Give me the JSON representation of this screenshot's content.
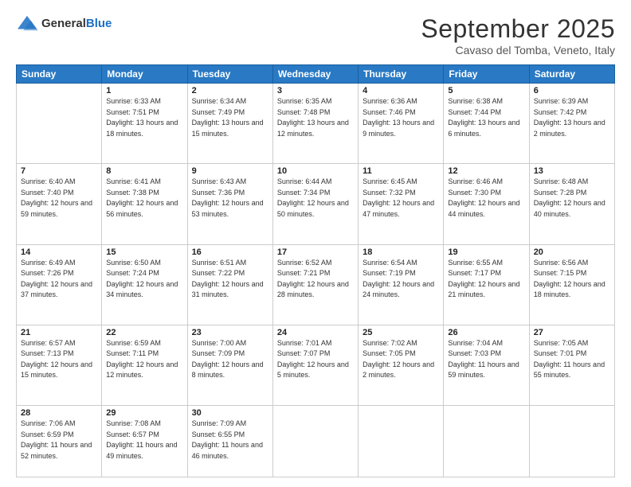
{
  "header": {
    "logo_general": "General",
    "logo_blue": "Blue",
    "month_title": "September 2025",
    "location": "Cavaso del Tomba, Veneto, Italy"
  },
  "days_of_week": [
    "Sunday",
    "Monday",
    "Tuesday",
    "Wednesday",
    "Thursday",
    "Friday",
    "Saturday"
  ],
  "weeks": [
    [
      {
        "num": "",
        "sunrise": "",
        "sunset": "",
        "daylight": ""
      },
      {
        "num": "1",
        "sunrise": "Sunrise: 6:33 AM",
        "sunset": "Sunset: 7:51 PM",
        "daylight": "Daylight: 13 hours and 18 minutes."
      },
      {
        "num": "2",
        "sunrise": "Sunrise: 6:34 AM",
        "sunset": "Sunset: 7:49 PM",
        "daylight": "Daylight: 13 hours and 15 minutes."
      },
      {
        "num": "3",
        "sunrise": "Sunrise: 6:35 AM",
        "sunset": "Sunset: 7:48 PM",
        "daylight": "Daylight: 13 hours and 12 minutes."
      },
      {
        "num": "4",
        "sunrise": "Sunrise: 6:36 AM",
        "sunset": "Sunset: 7:46 PM",
        "daylight": "Daylight: 13 hours and 9 minutes."
      },
      {
        "num": "5",
        "sunrise": "Sunrise: 6:38 AM",
        "sunset": "Sunset: 7:44 PM",
        "daylight": "Daylight: 13 hours and 6 minutes."
      },
      {
        "num": "6",
        "sunrise": "Sunrise: 6:39 AM",
        "sunset": "Sunset: 7:42 PM",
        "daylight": "Daylight: 13 hours and 2 minutes."
      }
    ],
    [
      {
        "num": "7",
        "sunrise": "Sunrise: 6:40 AM",
        "sunset": "Sunset: 7:40 PM",
        "daylight": "Daylight: 12 hours and 59 minutes."
      },
      {
        "num": "8",
        "sunrise": "Sunrise: 6:41 AM",
        "sunset": "Sunset: 7:38 PM",
        "daylight": "Daylight: 12 hours and 56 minutes."
      },
      {
        "num": "9",
        "sunrise": "Sunrise: 6:43 AM",
        "sunset": "Sunset: 7:36 PM",
        "daylight": "Daylight: 12 hours and 53 minutes."
      },
      {
        "num": "10",
        "sunrise": "Sunrise: 6:44 AM",
        "sunset": "Sunset: 7:34 PM",
        "daylight": "Daylight: 12 hours and 50 minutes."
      },
      {
        "num": "11",
        "sunrise": "Sunrise: 6:45 AM",
        "sunset": "Sunset: 7:32 PM",
        "daylight": "Daylight: 12 hours and 47 minutes."
      },
      {
        "num": "12",
        "sunrise": "Sunrise: 6:46 AM",
        "sunset": "Sunset: 7:30 PM",
        "daylight": "Daylight: 12 hours and 44 minutes."
      },
      {
        "num": "13",
        "sunrise": "Sunrise: 6:48 AM",
        "sunset": "Sunset: 7:28 PM",
        "daylight": "Daylight: 12 hours and 40 minutes."
      }
    ],
    [
      {
        "num": "14",
        "sunrise": "Sunrise: 6:49 AM",
        "sunset": "Sunset: 7:26 PM",
        "daylight": "Daylight: 12 hours and 37 minutes."
      },
      {
        "num": "15",
        "sunrise": "Sunrise: 6:50 AM",
        "sunset": "Sunset: 7:24 PM",
        "daylight": "Daylight: 12 hours and 34 minutes."
      },
      {
        "num": "16",
        "sunrise": "Sunrise: 6:51 AM",
        "sunset": "Sunset: 7:22 PM",
        "daylight": "Daylight: 12 hours and 31 minutes."
      },
      {
        "num": "17",
        "sunrise": "Sunrise: 6:52 AM",
        "sunset": "Sunset: 7:21 PM",
        "daylight": "Daylight: 12 hours and 28 minutes."
      },
      {
        "num": "18",
        "sunrise": "Sunrise: 6:54 AM",
        "sunset": "Sunset: 7:19 PM",
        "daylight": "Daylight: 12 hours and 24 minutes."
      },
      {
        "num": "19",
        "sunrise": "Sunrise: 6:55 AM",
        "sunset": "Sunset: 7:17 PM",
        "daylight": "Daylight: 12 hours and 21 minutes."
      },
      {
        "num": "20",
        "sunrise": "Sunrise: 6:56 AM",
        "sunset": "Sunset: 7:15 PM",
        "daylight": "Daylight: 12 hours and 18 minutes."
      }
    ],
    [
      {
        "num": "21",
        "sunrise": "Sunrise: 6:57 AM",
        "sunset": "Sunset: 7:13 PM",
        "daylight": "Daylight: 12 hours and 15 minutes."
      },
      {
        "num": "22",
        "sunrise": "Sunrise: 6:59 AM",
        "sunset": "Sunset: 7:11 PM",
        "daylight": "Daylight: 12 hours and 12 minutes."
      },
      {
        "num": "23",
        "sunrise": "Sunrise: 7:00 AM",
        "sunset": "Sunset: 7:09 PM",
        "daylight": "Daylight: 12 hours and 8 minutes."
      },
      {
        "num": "24",
        "sunrise": "Sunrise: 7:01 AM",
        "sunset": "Sunset: 7:07 PM",
        "daylight": "Daylight: 12 hours and 5 minutes."
      },
      {
        "num": "25",
        "sunrise": "Sunrise: 7:02 AM",
        "sunset": "Sunset: 7:05 PM",
        "daylight": "Daylight: 12 hours and 2 minutes."
      },
      {
        "num": "26",
        "sunrise": "Sunrise: 7:04 AM",
        "sunset": "Sunset: 7:03 PM",
        "daylight": "Daylight: 11 hours and 59 minutes."
      },
      {
        "num": "27",
        "sunrise": "Sunrise: 7:05 AM",
        "sunset": "Sunset: 7:01 PM",
        "daylight": "Daylight: 11 hours and 55 minutes."
      }
    ],
    [
      {
        "num": "28",
        "sunrise": "Sunrise: 7:06 AM",
        "sunset": "Sunset: 6:59 PM",
        "daylight": "Daylight: 11 hours and 52 minutes."
      },
      {
        "num": "29",
        "sunrise": "Sunrise: 7:08 AM",
        "sunset": "Sunset: 6:57 PM",
        "daylight": "Daylight: 11 hours and 49 minutes."
      },
      {
        "num": "30",
        "sunrise": "Sunrise: 7:09 AM",
        "sunset": "Sunset: 6:55 PM",
        "daylight": "Daylight: 11 hours and 46 minutes."
      },
      {
        "num": "",
        "sunrise": "",
        "sunset": "",
        "daylight": ""
      },
      {
        "num": "",
        "sunrise": "",
        "sunset": "",
        "daylight": ""
      },
      {
        "num": "",
        "sunrise": "",
        "sunset": "",
        "daylight": ""
      },
      {
        "num": "",
        "sunrise": "",
        "sunset": "",
        "daylight": ""
      }
    ]
  ]
}
